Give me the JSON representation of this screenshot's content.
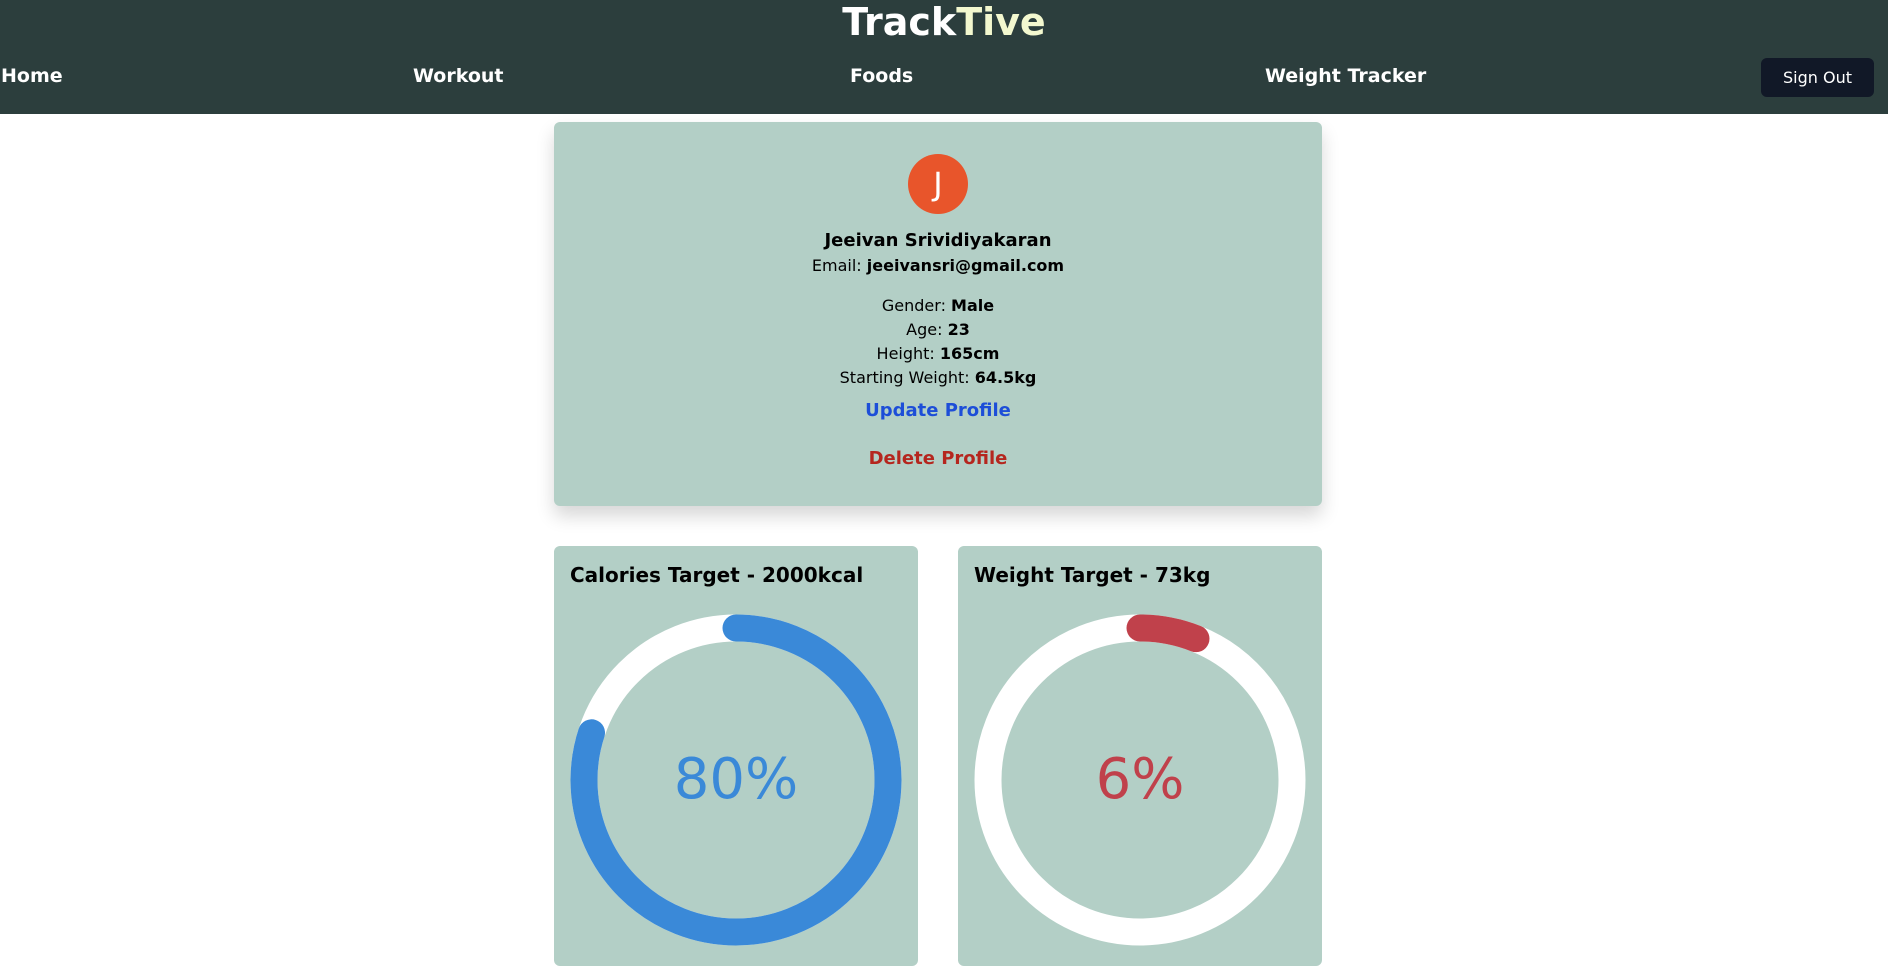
{
  "header": {
    "brand_part1": "Track",
    "brand_part2": "Tive",
    "nav": {
      "home": "Home",
      "workout": "Workout",
      "foods": "Foods",
      "weight_tracker": "Weight Tracker"
    },
    "sign_out": "Sign Out"
  },
  "profile": {
    "avatar_initial": "J",
    "name": "Jeeivan Srividiyakaran",
    "email_label": "Email: ",
    "email": "jeeivansri@gmail.com",
    "gender_label": "Gender: ",
    "gender": "Male",
    "age_label": "Age: ",
    "age": "23",
    "height_label": "Height: ",
    "height": "165cm",
    "starting_weight_label": "Starting Weight: ",
    "starting_weight": "64.5kg",
    "update_link": "Update Profile",
    "delete_link": "Delete Profile"
  },
  "targets": {
    "calories": {
      "title": "Calories Target - 2000kcal",
      "percent_text": "80%",
      "progress": 0.8,
      "color": "#3a89d8"
    },
    "weight": {
      "title": "Weight Target - 73kg",
      "percent_text": "6%",
      "progress": 0.06,
      "color": "#c0414b"
    }
  },
  "colors": {
    "header_bg": "#2c3e3d",
    "brand_accent": "#f3f8cf",
    "card_bg": "#b3cfc6",
    "avatar_bg": "#e8552b",
    "ring_track": "#ffffff"
  }
}
